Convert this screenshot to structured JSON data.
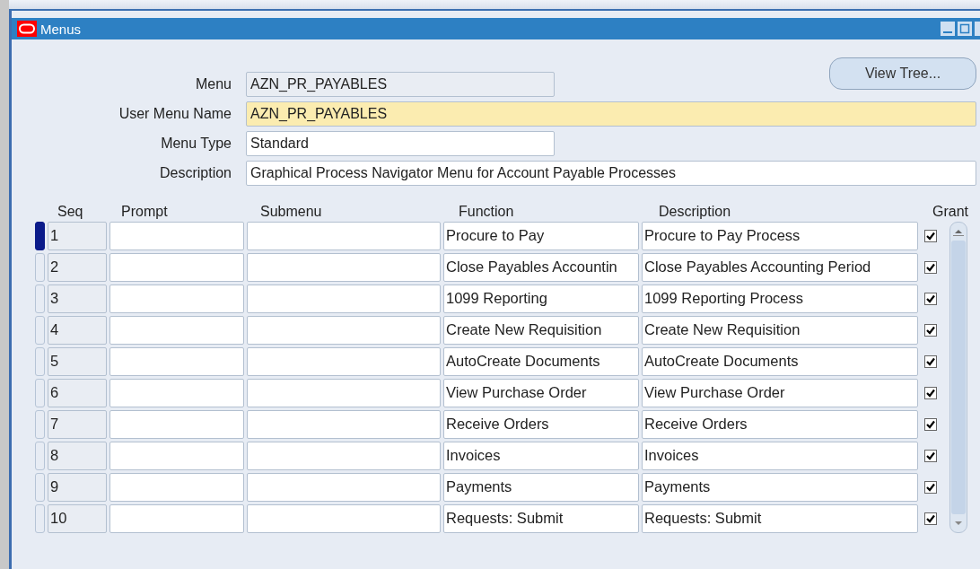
{
  "window": {
    "title": "Menus"
  },
  "view_tree_button": {
    "label": "View Tree..."
  },
  "form": [
    {
      "label": "Menu",
      "value": "AZN_PR_PAYABLES",
      "kind": "readonly"
    },
    {
      "label": "User Menu Name",
      "value": "AZN_PR_PAYABLES",
      "kind": "required"
    },
    {
      "label": "Menu Type",
      "value": "Standard",
      "kind": "short"
    },
    {
      "label": "Description",
      "value": "Graphical Process Navigator Menu for Account Payable Processes",
      "kind": "wide"
    }
  ],
  "table": {
    "columns": [
      "Seq",
      "Prompt",
      "Submenu",
      "Function",
      "Description",
      "Grant"
    ],
    "rows": [
      {
        "seq": "1",
        "prompt": "",
        "submenu": "",
        "function": "Procure to Pay",
        "description": "Procure to Pay Process",
        "grant": true,
        "selected": true
      },
      {
        "seq": "2",
        "prompt": "",
        "submenu": "",
        "function": "Close Payables Accountin",
        "description": "Close Payables Accounting Period",
        "grant": true,
        "selected": false
      },
      {
        "seq": "3",
        "prompt": "",
        "submenu": "",
        "function": "1099 Reporting",
        "description": "1099 Reporting Process",
        "grant": true,
        "selected": false
      },
      {
        "seq": "4",
        "prompt": "",
        "submenu": "",
        "function": "Create New Requisition",
        "description": "Create New Requisition",
        "grant": true,
        "selected": false
      },
      {
        "seq": "5",
        "prompt": "",
        "submenu": "",
        "function": "AutoCreate Documents",
        "description": "AutoCreate Documents",
        "grant": true,
        "selected": false
      },
      {
        "seq": "6",
        "prompt": "",
        "submenu": "",
        "function": "View Purchase Order",
        "description": "View Purchase Order",
        "grant": true,
        "selected": false
      },
      {
        "seq": "7",
        "prompt": "",
        "submenu": "",
        "function": "Receive Orders",
        "description": "Receive Orders",
        "grant": true,
        "selected": false
      },
      {
        "seq": "8",
        "prompt": "",
        "submenu": "",
        "function": "Invoices",
        "description": "Invoices",
        "grant": true,
        "selected": false
      },
      {
        "seq": "9",
        "prompt": "",
        "submenu": "",
        "function": "Payments",
        "description": "Payments",
        "grant": true,
        "selected": false
      },
      {
        "seq": "10",
        "prompt": "",
        "submenu": "",
        "function": "Requests: Submit",
        "description": "Requests: Submit",
        "grant": true,
        "selected": false
      }
    ]
  }
}
